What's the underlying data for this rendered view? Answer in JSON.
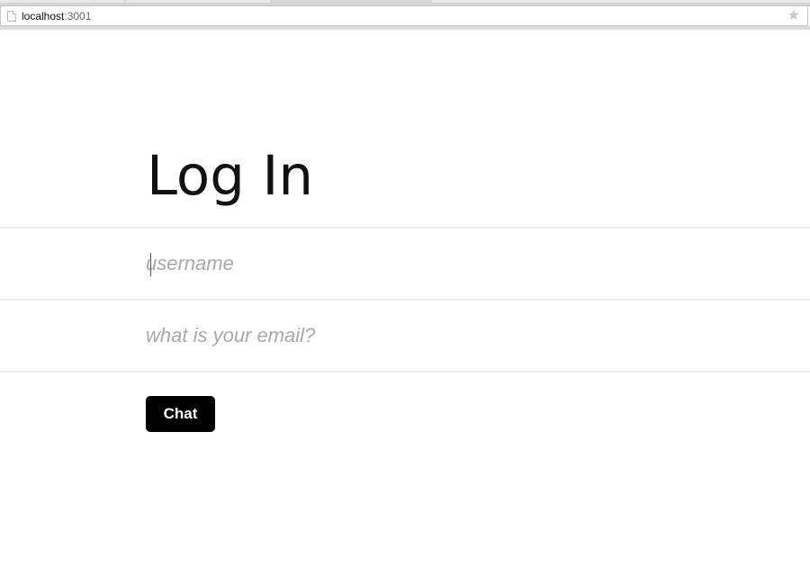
{
  "browser": {
    "url_host": "localhost",
    "url_port": ":3001",
    "bookmark_icon": "star-icon",
    "page_icon": "page-icon"
  },
  "form": {
    "title": "Log In",
    "username_placeholder": "username",
    "email_placeholder": "what is your email?",
    "submit_label": "Chat"
  },
  "colors": {
    "button_background": "#000000",
    "button_text": "#ffffff",
    "placeholder": "#a9a9a9",
    "divider": "#efefef"
  }
}
